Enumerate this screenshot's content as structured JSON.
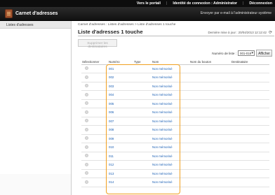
{
  "topbar": {
    "portal": "Vers le portail",
    "login_id": "Identité de connexion : Administrator",
    "logout": "Déconnexion"
  },
  "header": {
    "title": "Carnet d'adresses",
    "mail_admin": "Envoyer par e-mail à l'administrateur système"
  },
  "sidebar": {
    "items": [
      "Listes d'adresses"
    ]
  },
  "main": {
    "breadcrumb": "Carnet d'adresses : Listes d'adresses > Liste d'adresses 1 touche",
    "title": "Liste d'adresses 1 touche",
    "last_updated": "Dernière mise à jour : 20/04/2013 12:12:42",
    "delete_button": "Supprimer les destinataires",
    "list_number_label": "Numéro de liste :",
    "list_number_value": "001-018",
    "show_button": "Afficher",
    "columns": [
      "Sélectionner",
      "Numéro",
      "Type",
      "Nom",
      "Nom du bouton",
      "Destinataire"
    ],
    "rows": [
      {
        "num": "001",
        "name": "Non mémorisé"
      },
      {
        "num": "002",
        "name": "Non mémorisé"
      },
      {
        "num": "003",
        "name": "Non mémorisé"
      },
      {
        "num": "004",
        "name": "Non mémorisé"
      },
      {
        "num": "005",
        "name": "Non mémorisé"
      },
      {
        "num": "006",
        "name": "Non mémorisé"
      },
      {
        "num": "007",
        "name": "Non mémorisé"
      },
      {
        "num": "008",
        "name": "Non mémorisé"
      },
      {
        "num": "009",
        "name": "Non mémorisé"
      },
      {
        "num": "010",
        "name": "Non mémorisé"
      },
      {
        "num": "011",
        "name": "Non mémorisé"
      },
      {
        "num": "012",
        "name": "Non mémorisé"
      },
      {
        "num": "013",
        "name": "Non mémorisé"
      },
      {
        "num": "014",
        "name": "Non mémorisé"
      }
    ]
  },
  "colors": {
    "link": "#1a5fb4",
    "highlight": "#f0a020",
    "header_bg": "#111111"
  },
  "icons": {
    "logo": "address-book-icon",
    "refresh": "refresh-icon"
  }
}
